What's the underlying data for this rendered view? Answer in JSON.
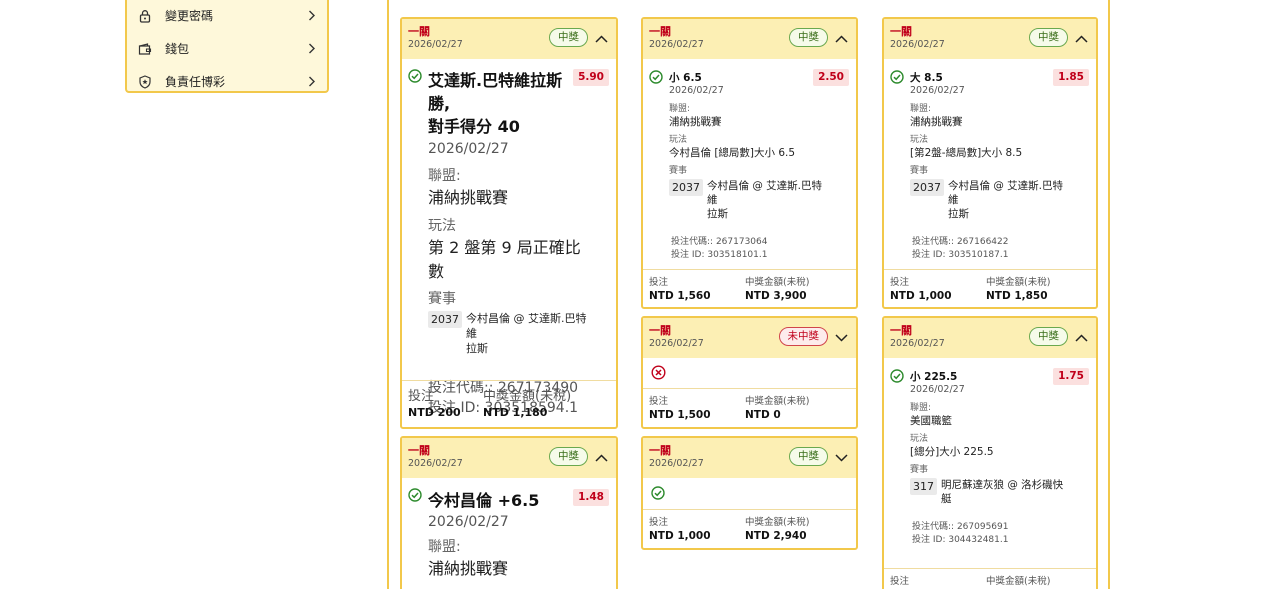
{
  "menu": {
    "items": [
      {
        "label": "變更密碼",
        "icon": "lock-icon"
      },
      {
        "label": "錢包",
        "icon": "wallet-icon"
      },
      {
        "label": "負責任博彩",
        "icon": "shield-icon"
      }
    ]
  },
  "labels": {
    "league": "聯盟:",
    "play": "玩法",
    "event": "賽事",
    "stake": "投注",
    "payout": "中獎金額(未稅)",
    "bet_code_prefix": "投注代碼:: ",
    "bet_id_prefix": "投注 ID: "
  },
  "colors": {
    "accent": "#f2c84b",
    "header_bg": "#fcefb4",
    "win": "#386d18",
    "lose": "#c0001a"
  },
  "cards": [
    {
      "title": "一關",
      "date": "2026/02/27",
      "status": "中獎",
      "expanded": true,
      "selection": "艾達斯.巴特維拉斯 勝, 對手得分 40",
      "selection_line1": "艾達斯.巴特維拉斯 勝,",
      "selection_line2": "對手得分 40",
      "selection_date": "2026/02/27",
      "odds": "5.90",
      "league": "浦納挑戰賽",
      "play_line1": "第 2 盤第 9 局正確比",
      "play_line2": "數",
      "event_id": "2037",
      "event_line1": "今村昌倫 @ 艾達斯.巴特維",
      "event_line2": "拉斯",
      "bet_code": "267173490",
      "bet_id": "303518594.1",
      "stake": "NTD 200",
      "payout": "NTD 1,180"
    },
    {
      "title": "一關",
      "date": "2026/02/27",
      "status": "中獎",
      "expanded": true,
      "selection": "小 6.5",
      "selection_date": "2026/02/27",
      "odds": "2.50",
      "league": "浦納挑戰賽",
      "play": "今村昌倫 [總局數]大小 6.5",
      "event_id": "2037",
      "event_line1": "今村昌倫 @ 艾達斯.巴特維",
      "event_line2": "拉斯",
      "bet_code": "267173064",
      "bet_id": "303518101.1",
      "stake": "NTD 1,560",
      "payout": "NTD 3,900"
    },
    {
      "title": "一關",
      "date": "2026/02/27",
      "status": "中獎",
      "expanded": true,
      "selection": "大 8.5",
      "selection_date": "2026/02/27",
      "odds": "1.85",
      "league": "浦納挑戰賽",
      "play": "[第2盤-總局數]大小 8.5",
      "event_id": "2037",
      "event_line1": "今村昌倫 @ 艾達斯.巴特維",
      "event_line2": "拉斯",
      "bet_code": "267166422",
      "bet_id": "303510187.1",
      "stake": "NTD 1,000",
      "payout": "NTD 1,850"
    },
    {
      "title": "一關",
      "date": "2026/02/27",
      "status": "中獎",
      "expanded": true,
      "selection": "今村昌倫 +6.5",
      "selection_date": "2026/02/27",
      "odds": "1.48",
      "league": "浦納挑戰賽"
    },
    {
      "title": "一關",
      "date": "2026/02/27",
      "status": "未中獎",
      "expanded": false,
      "stake": "NTD 1,500",
      "payout": "NTD 0"
    },
    {
      "title": "一關",
      "date": "2026/02/27",
      "status": "中獎",
      "expanded": false,
      "stake": "NTD 1,000",
      "payout": "NTD 2,940"
    },
    {
      "title": "一關",
      "date": "2026/02/27",
      "status": "中獎",
      "expanded": true,
      "selection": "小 225.5",
      "selection_date": "2026/02/27",
      "odds": "1.75",
      "league": "美國職籃",
      "play": "[總分]大小 225.5",
      "event_id": "317",
      "event_line1": "明尼蘇達灰狼 @ 洛杉磯快",
      "event_line2": "艇",
      "bet_code": "267095691",
      "bet_id": "304432481.1"
    }
  ]
}
